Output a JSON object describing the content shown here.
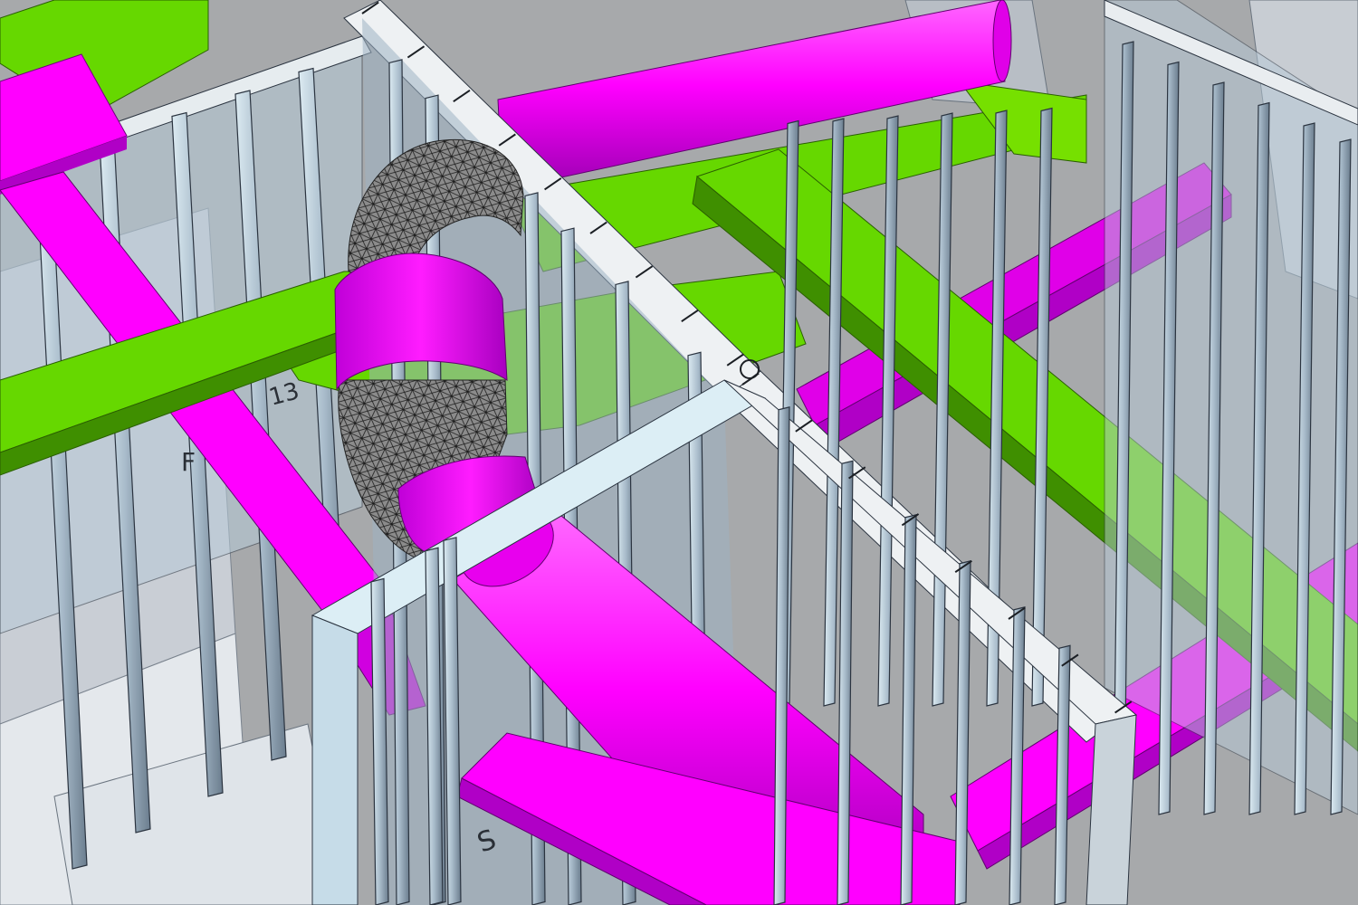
{
  "viewport": {
    "kind": "3d-model-view",
    "colors": {
      "background": "#a9a9a9",
      "floor_panel": "#c6ccd4",
      "stud_light": "#cfe2ec",
      "stud_dark": "#6e7f90",
      "stud_edge": "#2b3440",
      "wall_top": "#e9edf0",
      "duct_magenta": "#ff00ff",
      "duct_magenta_dark": "#a000b4",
      "tray_green": "#66d800",
      "tray_green_dark": "#3f8f00",
      "flex_duct_mesh": "#8a8a8a",
      "flex_duct_line": "#1a1a1a"
    }
  },
  "tags": [
    {
      "text": "13"
    },
    {
      "text": "F"
    },
    {
      "text": "S"
    }
  ]
}
